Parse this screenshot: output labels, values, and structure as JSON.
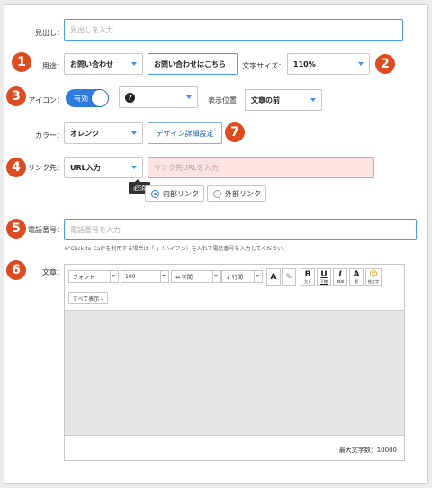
{
  "badges": [
    "1",
    "2",
    "3",
    "4",
    "5",
    "6",
    "7"
  ],
  "heading": {
    "label": "見出し：",
    "placeholder": "見出しを入力"
  },
  "purpose": {
    "label": "用途：",
    "select_value": "お問い合わせ",
    "text_value": "お問い合わせはこちら"
  },
  "font_size": {
    "label": "文字サイズ：",
    "value": "110%"
  },
  "icon": {
    "label": "アイコン：",
    "toggle_label": "有効",
    "toggle_on": true,
    "icon_select_glyph": "?"
  },
  "display_position": {
    "label": "表示位置",
    "value": "文章の前"
  },
  "color": {
    "label": "カラー：",
    "value": "オレンジ",
    "design_button": "デザイン詳細設定"
  },
  "link": {
    "label": "リンク先：",
    "type_value": "URL入力",
    "url_placeholder": "リンク先URLを入力",
    "required_tooltip": "必須",
    "internal_label": "内部リンク",
    "external_label": "外部リンク"
  },
  "phone": {
    "label": "電話番号：",
    "placeholder": "電話番号を入力",
    "note": "※\"Click-to-Call\"を利用する場合は「-」（ハイフン）を入れて電話番号を入力してください。"
  },
  "body_text": {
    "label": "文章：",
    "toolbar": {
      "font": "フォント",
      "size": "100",
      "spacing": "↔ 字間",
      "line_height": "↕ 行間",
      "text_color": "A",
      "highlight": "✎",
      "bold": {
        "glyph": "B",
        "caption": "太く"
      },
      "underline": {
        "glyph": "U",
        "caption": "下線"
      },
      "italic": {
        "glyph": "I",
        "caption": "斜体"
      },
      "background": {
        "glyph": "A",
        "caption": "影"
      },
      "emoji": {
        "glyph": "☺",
        "caption": "絵文字"
      },
      "show_all": "すべて表示 –"
    },
    "char_limit": "最大文字数：10000"
  },
  "colors": {
    "accent": "#dd4b21",
    "primary": "#2f7be0",
    "error_bg": "#fde4e4"
  }
}
